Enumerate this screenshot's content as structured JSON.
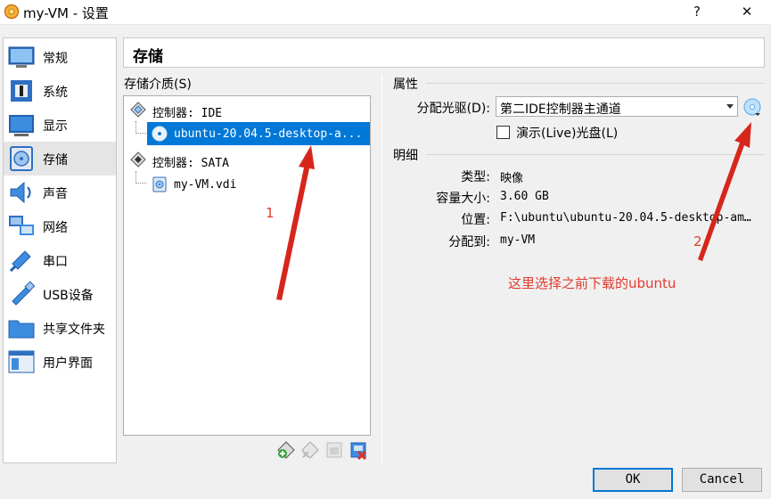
{
  "window": {
    "title": "my-VM - 设置",
    "help": "?",
    "close": "✕"
  },
  "sidebar": {
    "items": [
      {
        "label": "常规"
      },
      {
        "label": "系统"
      },
      {
        "label": "显示"
      },
      {
        "label": "存储"
      },
      {
        "label": "声音"
      },
      {
        "label": "网络"
      },
      {
        "label": "串口"
      },
      {
        "label": "USB设备"
      },
      {
        "label": "共享文件夹"
      },
      {
        "label": "用户界面"
      }
    ]
  },
  "page": {
    "title": "存储"
  },
  "storage": {
    "heading": "存储介质(S)",
    "tree": {
      "ide_controller": "控制器: IDE",
      "ide_disc": "ubuntu-20.04.5-desktop-a...",
      "sata_controller": "控制器: SATA",
      "sata_disk": "my-VM.vdi"
    }
  },
  "attributes": {
    "heading": "属性",
    "optical_drive_label": "分配光驱(D):",
    "optical_drive_value": "第二IDE控制器主通道",
    "live_cd_label": "演示(Live)光盘(L)",
    "live_cd_checked": false
  },
  "details": {
    "heading": "明细",
    "type_label": "类型:",
    "type_value": "映像",
    "size_label": "容量大小:",
    "size_value": "3.60 GB",
    "location_label": "位置:",
    "location_value": "F:\\ubuntu\\ubuntu-20.04.5-desktop-am…",
    "attached_label": "分配到:",
    "attached_value": "my-VM"
  },
  "annotations": {
    "marker_1": "1",
    "marker_2": "2",
    "note": "这里选择之前下载的ubuntu",
    "color": "#e23a2e"
  },
  "buttons": {
    "ok": "OK",
    "cancel": "Cancel"
  },
  "colors": {
    "selection": "#0078d7",
    "window_bg": "#f0f0f0"
  }
}
